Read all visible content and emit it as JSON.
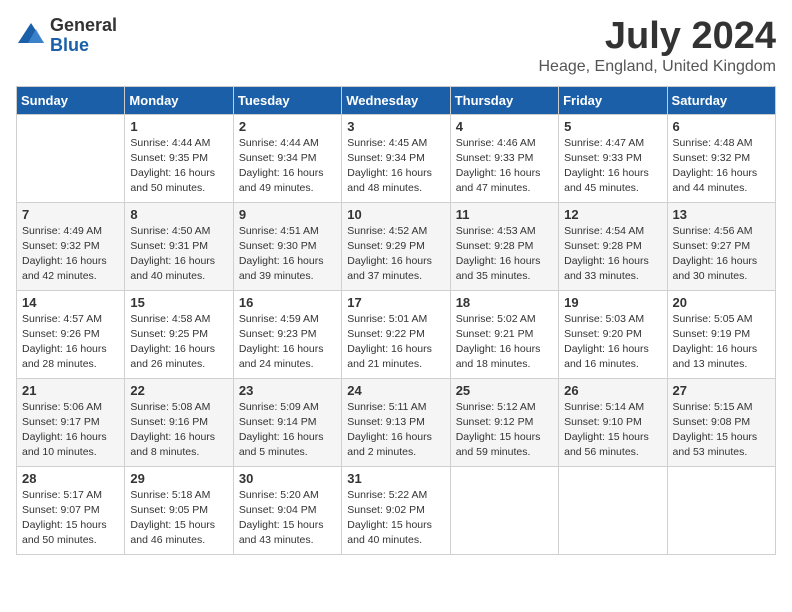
{
  "logo": {
    "general": "General",
    "blue": "Blue"
  },
  "title": "July 2024",
  "location": "Heage, England, United Kingdom",
  "weekdays": [
    "Sunday",
    "Monday",
    "Tuesday",
    "Wednesday",
    "Thursday",
    "Friday",
    "Saturday"
  ],
  "weeks": [
    [
      {
        "day": "",
        "sunrise": "",
        "sunset": "",
        "daylight": ""
      },
      {
        "day": "1",
        "sunrise": "Sunrise: 4:44 AM",
        "sunset": "Sunset: 9:35 PM",
        "daylight": "Daylight: 16 hours and 50 minutes."
      },
      {
        "day": "2",
        "sunrise": "Sunrise: 4:44 AM",
        "sunset": "Sunset: 9:34 PM",
        "daylight": "Daylight: 16 hours and 49 minutes."
      },
      {
        "day": "3",
        "sunrise": "Sunrise: 4:45 AM",
        "sunset": "Sunset: 9:34 PM",
        "daylight": "Daylight: 16 hours and 48 minutes."
      },
      {
        "day": "4",
        "sunrise": "Sunrise: 4:46 AM",
        "sunset": "Sunset: 9:33 PM",
        "daylight": "Daylight: 16 hours and 47 minutes."
      },
      {
        "day": "5",
        "sunrise": "Sunrise: 4:47 AM",
        "sunset": "Sunset: 9:33 PM",
        "daylight": "Daylight: 16 hours and 45 minutes."
      },
      {
        "day": "6",
        "sunrise": "Sunrise: 4:48 AM",
        "sunset": "Sunset: 9:32 PM",
        "daylight": "Daylight: 16 hours and 44 minutes."
      }
    ],
    [
      {
        "day": "7",
        "sunrise": "Sunrise: 4:49 AM",
        "sunset": "Sunset: 9:32 PM",
        "daylight": "Daylight: 16 hours and 42 minutes."
      },
      {
        "day": "8",
        "sunrise": "Sunrise: 4:50 AM",
        "sunset": "Sunset: 9:31 PM",
        "daylight": "Daylight: 16 hours and 40 minutes."
      },
      {
        "day": "9",
        "sunrise": "Sunrise: 4:51 AM",
        "sunset": "Sunset: 9:30 PM",
        "daylight": "Daylight: 16 hours and 39 minutes."
      },
      {
        "day": "10",
        "sunrise": "Sunrise: 4:52 AM",
        "sunset": "Sunset: 9:29 PM",
        "daylight": "Daylight: 16 hours and 37 minutes."
      },
      {
        "day": "11",
        "sunrise": "Sunrise: 4:53 AM",
        "sunset": "Sunset: 9:28 PM",
        "daylight": "Daylight: 16 hours and 35 minutes."
      },
      {
        "day": "12",
        "sunrise": "Sunrise: 4:54 AM",
        "sunset": "Sunset: 9:28 PM",
        "daylight": "Daylight: 16 hours and 33 minutes."
      },
      {
        "day": "13",
        "sunrise": "Sunrise: 4:56 AM",
        "sunset": "Sunset: 9:27 PM",
        "daylight": "Daylight: 16 hours and 30 minutes."
      }
    ],
    [
      {
        "day": "14",
        "sunrise": "Sunrise: 4:57 AM",
        "sunset": "Sunset: 9:26 PM",
        "daylight": "Daylight: 16 hours and 28 minutes."
      },
      {
        "day": "15",
        "sunrise": "Sunrise: 4:58 AM",
        "sunset": "Sunset: 9:25 PM",
        "daylight": "Daylight: 16 hours and 26 minutes."
      },
      {
        "day": "16",
        "sunrise": "Sunrise: 4:59 AM",
        "sunset": "Sunset: 9:23 PM",
        "daylight": "Daylight: 16 hours and 24 minutes."
      },
      {
        "day": "17",
        "sunrise": "Sunrise: 5:01 AM",
        "sunset": "Sunset: 9:22 PM",
        "daylight": "Daylight: 16 hours and 21 minutes."
      },
      {
        "day": "18",
        "sunrise": "Sunrise: 5:02 AM",
        "sunset": "Sunset: 9:21 PM",
        "daylight": "Daylight: 16 hours and 18 minutes."
      },
      {
        "day": "19",
        "sunrise": "Sunrise: 5:03 AM",
        "sunset": "Sunset: 9:20 PM",
        "daylight": "Daylight: 16 hours and 16 minutes."
      },
      {
        "day": "20",
        "sunrise": "Sunrise: 5:05 AM",
        "sunset": "Sunset: 9:19 PM",
        "daylight": "Daylight: 16 hours and 13 minutes."
      }
    ],
    [
      {
        "day": "21",
        "sunrise": "Sunrise: 5:06 AM",
        "sunset": "Sunset: 9:17 PM",
        "daylight": "Daylight: 16 hours and 10 minutes."
      },
      {
        "day": "22",
        "sunrise": "Sunrise: 5:08 AM",
        "sunset": "Sunset: 9:16 PM",
        "daylight": "Daylight: 16 hours and 8 minutes."
      },
      {
        "day": "23",
        "sunrise": "Sunrise: 5:09 AM",
        "sunset": "Sunset: 9:14 PM",
        "daylight": "Daylight: 16 hours and 5 minutes."
      },
      {
        "day": "24",
        "sunrise": "Sunrise: 5:11 AM",
        "sunset": "Sunset: 9:13 PM",
        "daylight": "Daylight: 16 hours and 2 minutes."
      },
      {
        "day": "25",
        "sunrise": "Sunrise: 5:12 AM",
        "sunset": "Sunset: 9:12 PM",
        "daylight": "Daylight: 15 hours and 59 minutes."
      },
      {
        "day": "26",
        "sunrise": "Sunrise: 5:14 AM",
        "sunset": "Sunset: 9:10 PM",
        "daylight": "Daylight: 15 hours and 56 minutes."
      },
      {
        "day": "27",
        "sunrise": "Sunrise: 5:15 AM",
        "sunset": "Sunset: 9:08 PM",
        "daylight": "Daylight: 15 hours and 53 minutes."
      }
    ],
    [
      {
        "day": "28",
        "sunrise": "Sunrise: 5:17 AM",
        "sunset": "Sunset: 9:07 PM",
        "daylight": "Daylight: 15 hours and 50 minutes."
      },
      {
        "day": "29",
        "sunrise": "Sunrise: 5:18 AM",
        "sunset": "Sunset: 9:05 PM",
        "daylight": "Daylight: 15 hours and 46 minutes."
      },
      {
        "day": "30",
        "sunrise": "Sunrise: 5:20 AM",
        "sunset": "Sunset: 9:04 PM",
        "daylight": "Daylight: 15 hours and 43 minutes."
      },
      {
        "day": "31",
        "sunrise": "Sunrise: 5:22 AM",
        "sunset": "Sunset: 9:02 PM",
        "daylight": "Daylight: 15 hours and 40 minutes."
      },
      {
        "day": "",
        "sunrise": "",
        "sunset": "",
        "daylight": ""
      },
      {
        "day": "",
        "sunrise": "",
        "sunset": "",
        "daylight": ""
      },
      {
        "day": "",
        "sunrise": "",
        "sunset": "",
        "daylight": ""
      }
    ]
  ]
}
